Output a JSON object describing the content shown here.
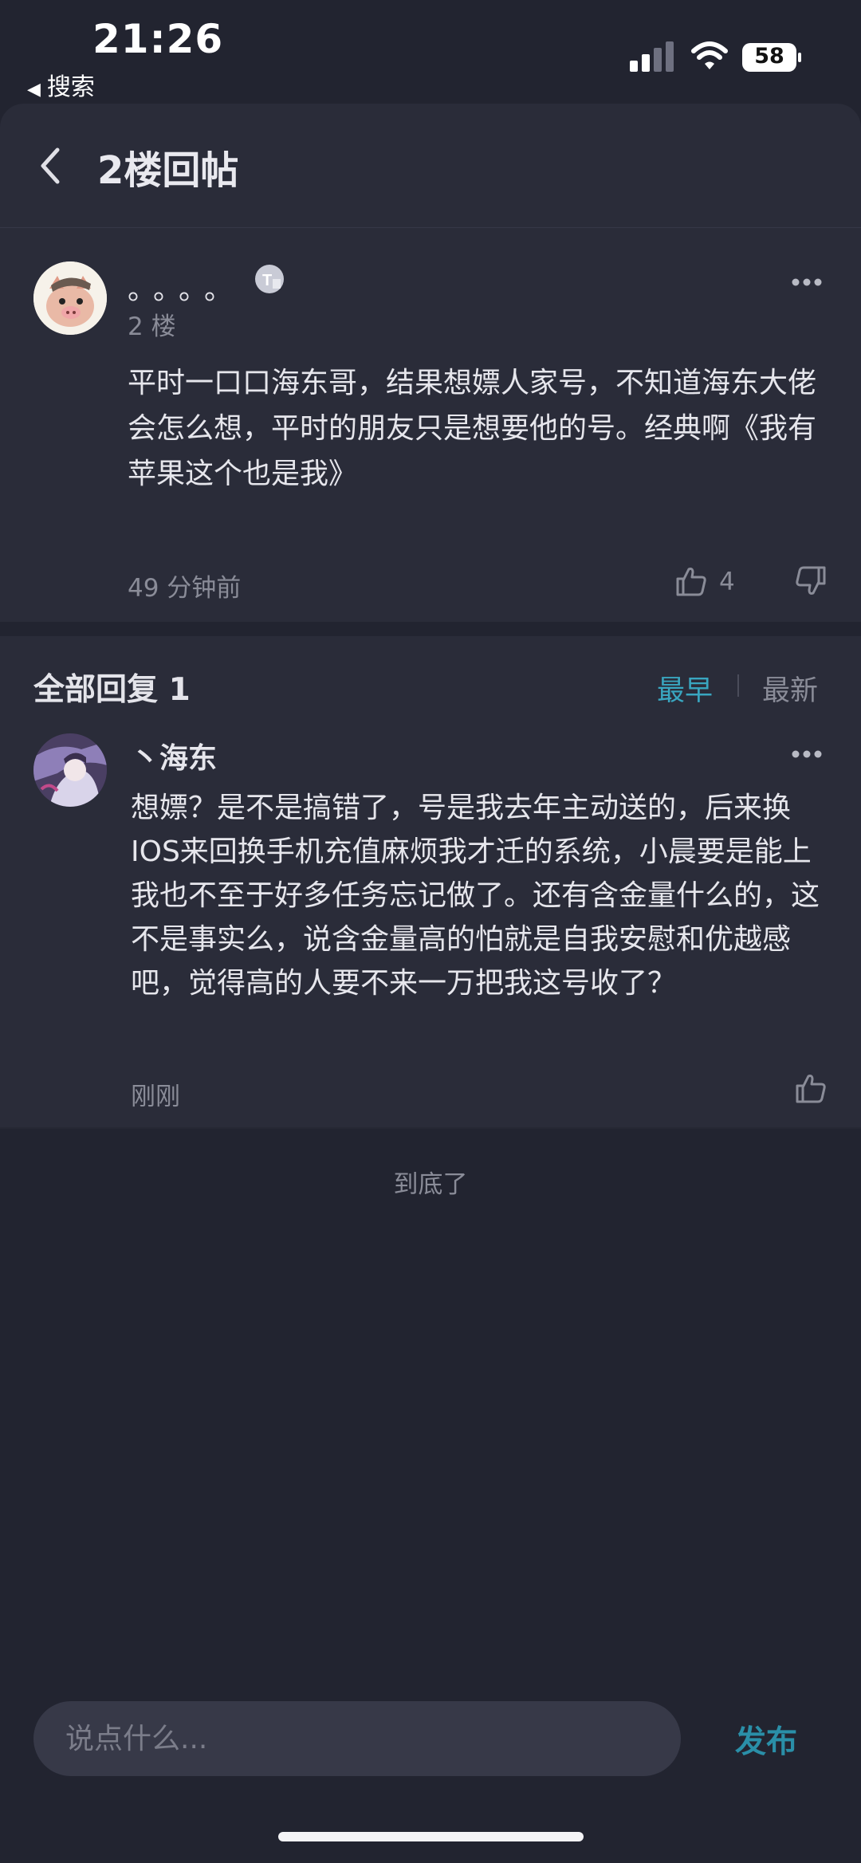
{
  "status_bar": {
    "time": "21:26",
    "back_app": "搜索",
    "battery": "58"
  },
  "header": {
    "title": "2楼回帖"
  },
  "post": {
    "username": "。。。。",
    "floor": "2 楼",
    "content": "平时一口口海东哥，结果想嫖人家号，不知道海东大佬会怎么想，平时的朋友只是想要他的号。经典啊《我有苹果这个也是我》",
    "time": "49 分钟前",
    "likes": "4"
  },
  "replies": {
    "title": "全部回复 1",
    "sort_earliest": "最早",
    "sort_newest": "最新",
    "items": [
      {
        "username": "丶海东",
        "content": "想嫖？是不是搞错了，号是我去年主动送的，后来换IOS来回换手机充值麻烦我才迁的系统，小晨要是能上我也不至于好多任务忘记做了。还有含金量什么的，这不是事实么，说含金量高的怕就是自我安慰和优越感吧，觉得高的人要不来一万把我这号收了？",
        "time": "刚刚"
      }
    ],
    "end_text": "到底了"
  },
  "composer": {
    "placeholder": "说点什么...",
    "publish_label": "发布"
  },
  "colors": {
    "accent": "#39a6c0",
    "background": "#222430",
    "card": "#2a2c39"
  }
}
